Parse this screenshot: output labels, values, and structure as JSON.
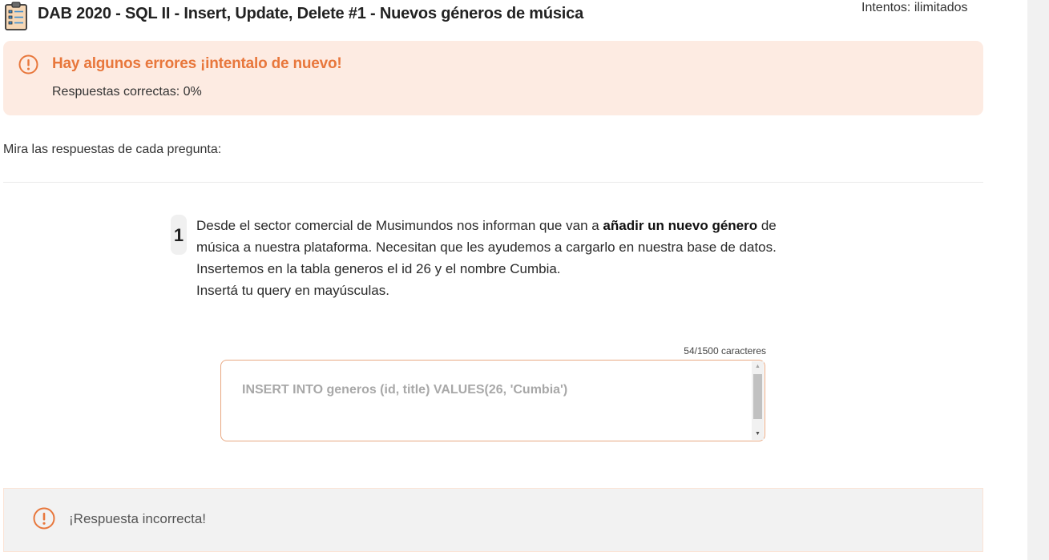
{
  "header": {
    "title": "DAB 2020 - SQL II - Insert, Update, Delete #1 - Nuevos géneros de música",
    "attempts": "Intentos: ilimitados",
    "icon": "clipboard-checklist-icon"
  },
  "error_banner": {
    "icon": "exclamation-circle-icon",
    "title": "Hay algunos errores ¡intentalo de nuevo!",
    "score_label": "Respuestas correctas: 0%"
  },
  "review": {
    "label": "Mira las respuestas de cada pregunta:"
  },
  "question": {
    "number": "1",
    "text_before_bold": "Desde el sector comercial de Musimundos nos informan que van a ",
    "text_bold": "añadir un nuevo género",
    "text_after_bold": " de música a nuestra plataforma. Necesitan que les ayudemos a cargarlo en nuestra base de datos.",
    "line_3": "Insertemos en la tabla generos el id 26 y el nombre Cumbia.",
    "line_4": "Insertá tu query en mayúsculas."
  },
  "answer": {
    "char_count": "54/1500 caracteres",
    "value": "INSERT INTO generos (id, title) VALUES(26, 'Cumbia')"
  },
  "result": {
    "icon": "exclamation-circle-icon",
    "text": "¡Respuesta incorrecta!"
  },
  "colors": {
    "accent_orange": "#e8773c",
    "banner_bg": "#fdebe2",
    "result_bg": "#f2f2f2"
  }
}
